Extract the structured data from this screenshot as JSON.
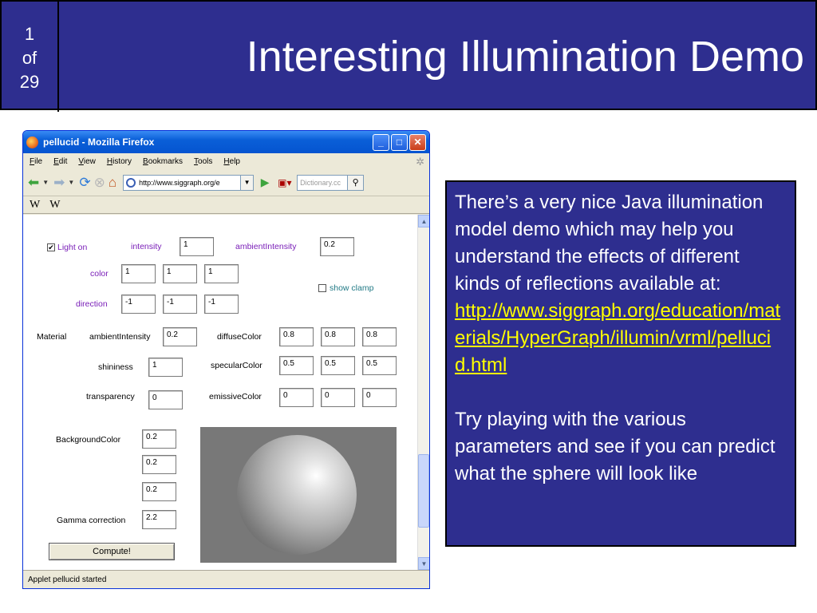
{
  "slide": {
    "page_current": "1",
    "page_of": "of",
    "page_total": "29",
    "title": "Interesting Illumination Demo"
  },
  "browser": {
    "title": "pellucid - Mozilla Firefox",
    "menu": [
      "File",
      "Edit",
      "View",
      "History",
      "Bookmarks",
      "Tools",
      "Help"
    ],
    "url": "http://www.siggraph.org/e",
    "search_placeholder": "Dictionary.cc",
    "bookmarks": [
      "W",
      "W"
    ],
    "status": "Applet pellucid started"
  },
  "applet": {
    "light_on_label": "Light on",
    "light_on_checked": "✔",
    "intensity_label": "intensity",
    "intensity_value": "1",
    "ambient_intensity_label": "ambientIntensity",
    "ambient_intensity_value": "0.2",
    "color_label": "color",
    "color_values": [
      "1",
      "1",
      "1"
    ],
    "show_clamp_label": "show clamp",
    "direction_label": "direction",
    "direction_values": [
      "-1",
      "-1",
      "-1"
    ],
    "material_label": "Material",
    "mat_ambient_label": "ambientIntensity",
    "mat_ambient_value": "0.2",
    "diffuse_label": "diffuseColor",
    "diffuse_values": [
      "0.8",
      "0.8",
      "0.8"
    ],
    "shininess_label": "shininess",
    "shininess_value": "1",
    "specular_label": "specularColor",
    "specular_values": [
      "0.5",
      "0.5",
      "0.5"
    ],
    "transparency_label": "transparency",
    "transparency_value": "0",
    "emissive_label": "emissiveColor",
    "emissive_values": [
      "0",
      "0",
      "0"
    ],
    "background_label": "BackgroundColor",
    "background_values": [
      "0.2",
      "0.2",
      "0.2"
    ],
    "gamma_label": "Gamma correction",
    "gamma_value": "2.2",
    "compute_label": "Compute!"
  },
  "info": {
    "paragraph1": "There’s a very nice Java illumination model demo which may help you understand the effects of different kinds of reflections available at:",
    "link": "http://www.siggraph.org/education/materials/HyperGraph/illumin/vrml/pellucid.html",
    "paragraph2": "Try playing with the various parameters and see if you can predict what the sphere will look like"
  },
  "colors": {
    "slide_blue": "#2e2e8f",
    "link_yellow": "#ffff00"
  }
}
